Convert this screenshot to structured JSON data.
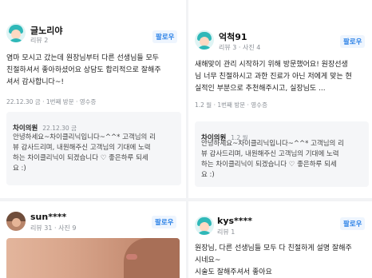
{
  "reviews": [
    {
      "username": "글노리야",
      "meta": "리뷰 2",
      "follow": "팔로우",
      "lines": [
        "염마 모시고 갔는데 원장님부터 다른 선생님들 모두",
        "친절하셔서 좋아하셨어요 상담도 합리적으로 잘해주",
        "셔서 감사합니다~!"
      ],
      "more": "",
      "info": "22.12.30 금 · 1번째 방문 · 영수증",
      "reply": {
        "name": "차이의원",
        "date": "22.12.30 금",
        "lines": [
          "안녕하세요~차이클리닉입니다~^^* 고객님의 리",
          "뷰 감사드리며, 내원해주신 고객님의 기대에 노력",
          "하는 차이클리닉이 되겠습니다 ♡ 좋은하루 되세",
          "요 :)"
        ]
      }
    },
    {
      "username": "억척91",
      "meta": "리뷰 3 · 사진 4",
      "follow": "팔로우",
      "lines": [
        "새해맞이 관리 시작하기 위해 방문했어요! 원장선생",
        "님 너무 친절하시고 과한 진료가 아닌 저에게 맞는 현",
        "실적인 부분으로 추천해주시고, 실장님도 ..."
      ],
      "more": "",
      "info": "1.2 월 · 1번째 방문 · 영수증",
      "reply": {
        "name": "차이의원",
        "date": "1.2 월",
        "lines": [
          "안녕하세요~차이클리닉입니다~^^* 고객님의 리",
          "뷰 감사드리며, 내원해주신 고객님의 기대에 노력",
          "하는 차이클리닉이 되겠습니다 ♡ 좋은하루 되세",
          "요 :)"
        ]
      }
    },
    {
      "username": "sun****",
      "meta": "리뷰 31 · 사진 9",
      "follow": "팔로우"
    },
    {
      "username": "kys****",
      "meta": "리뷰 1",
      "follow": "팔로우",
      "lines": [
        "원장님, 다른 선생님들 모두 다 친절하게 설명 잘해주",
        "시네요~",
        "시술도 잘해주셔서 좋아요"
      ]
    }
  ]
}
